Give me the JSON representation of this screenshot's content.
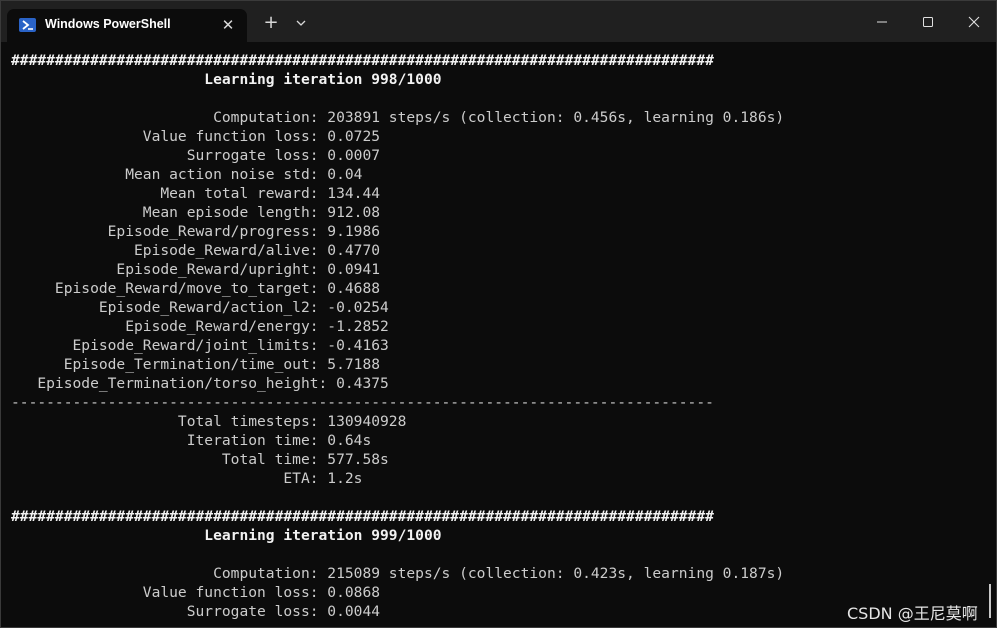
{
  "window": {
    "tab_title": "Windows PowerShell",
    "tab_close": "✕",
    "new_tab": "+",
    "colors": {
      "background": "#0c0c0c",
      "titlebar": "#202020",
      "text": "#cccccc",
      "icon": "#2a63c7"
    }
  },
  "terminal": {
    "lines": [
      {
        "text": "################################################################################",
        "bold": true
      },
      {
        "text": "                      Learning iteration 998/1000",
        "bold": true
      },
      {
        "text": "",
        "bold": false
      },
      {
        "text": "                       Computation: 203891 steps/s (collection: 0.456s, learning 0.186s)",
        "bold": false
      },
      {
        "text": "               Value function loss: 0.0725",
        "bold": false
      },
      {
        "text": "                    Surrogate loss: 0.0007",
        "bold": false
      },
      {
        "text": "             Mean action noise std: 0.04",
        "bold": false
      },
      {
        "text": "                 Mean total reward: 134.44",
        "bold": false
      },
      {
        "text": "               Mean episode length: 912.08",
        "bold": false
      },
      {
        "text": "           Episode_Reward/progress: 9.1986",
        "bold": false
      },
      {
        "text": "              Episode_Reward/alive: 0.4770",
        "bold": false
      },
      {
        "text": "            Episode_Reward/upright: 0.0941",
        "bold": false
      },
      {
        "text": "     Episode_Reward/move_to_target: 0.4688",
        "bold": false
      },
      {
        "text": "          Episode_Reward/action_l2: -0.0254",
        "bold": false
      },
      {
        "text": "             Episode_Reward/energy: -1.2852",
        "bold": false
      },
      {
        "text": "       Episode_Reward/joint_limits: -0.4163",
        "bold": false
      },
      {
        "text": "      Episode_Termination/time_out: 5.7188",
        "bold": false
      },
      {
        "text": "   Episode_Termination/torso_height: 0.4375",
        "bold": false
      },
      {
        "text": "--------------------------------------------------------------------------------",
        "bold": false
      },
      {
        "text": "                   Total timesteps: 130940928",
        "bold": false
      },
      {
        "text": "                    Iteration time: 0.64s",
        "bold": false
      },
      {
        "text": "                        Total time: 577.58s",
        "bold": false
      },
      {
        "text": "                               ETA: 1.2s",
        "bold": false
      },
      {
        "text": "",
        "bold": false
      },
      {
        "text": "################################################################################",
        "bold": true
      },
      {
        "text": "                      Learning iteration 999/1000",
        "bold": true
      },
      {
        "text": "",
        "bold": false
      },
      {
        "text": "                       Computation: 215089 steps/s (collection: 0.423s, learning 0.187s)",
        "bold": false
      },
      {
        "text": "               Value function loss: 0.0868",
        "bold": false
      },
      {
        "text": "                    Surrogate loss: 0.0044",
        "bold": false
      }
    ]
  },
  "watermark": "CSDN @王尼莫啊"
}
